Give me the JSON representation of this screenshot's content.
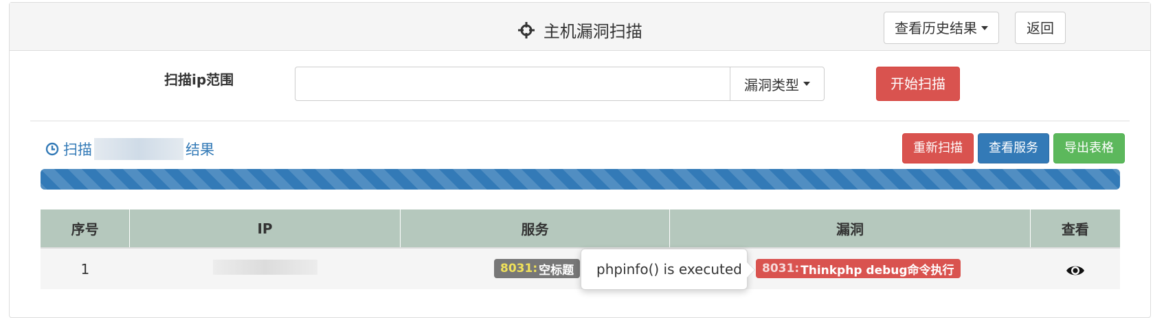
{
  "header": {
    "title": "主机漏洞扫描",
    "history_label": "查看历史结果",
    "back_label": "返回"
  },
  "form": {
    "range_label": "扫描ip范围",
    "range_value": "",
    "vuln_type_label": "漏洞类型",
    "start_label": "开始扫描"
  },
  "results": {
    "title_prefix": "扫描",
    "title_suffix": "结果",
    "rescan_label": "重新扫描",
    "services_label": "查看服务",
    "export_label": "导出表格",
    "progress_fraction": 1.0
  },
  "table": {
    "headers": [
      "序号",
      "IP",
      "服务",
      "漏洞",
      "查看"
    ],
    "rows": [
      {
        "index": "1",
        "service_port": "8031:",
        "service_name": "空标题",
        "vuln_port": "8031:",
        "vuln_name": "Thinkphp debug命令执行"
      }
    ]
  },
  "tooltip": {
    "text": "phpinfo() is executed"
  },
  "icons": {
    "title_icon": "crosshair-icon",
    "result_icon": "clock-icon",
    "view_icon": "eye-icon"
  },
  "colors": {
    "danger": "#d9534f",
    "primary": "#337ab7",
    "success": "#5cb85c",
    "table_header": "#b5c8bd"
  }
}
